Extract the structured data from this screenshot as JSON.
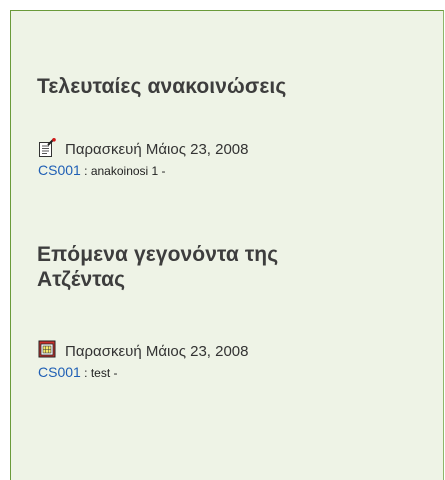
{
  "announcements": {
    "title": "Τελευταίες ανακοινώσεις",
    "icon": "announcement-icon",
    "date": "Παρασκευή Μάιος 23, 2008",
    "course": "CS001",
    "separator": " : ",
    "text": "anakoinosi 1 -"
  },
  "agenda": {
    "title": "Επόμενα γεγονόντα της Ατζέντας",
    "icon": "calendar-icon",
    "date": "Παρασκευή Μάιος 23, 2008",
    "course": "CS001",
    "separator": " : ",
    "text": "test -"
  },
  "colors": {
    "panel_background": "#eef3e6",
    "panel_border": "#6a9a3a",
    "link": "#1f5fb5",
    "heading": "#3d3d3d"
  }
}
